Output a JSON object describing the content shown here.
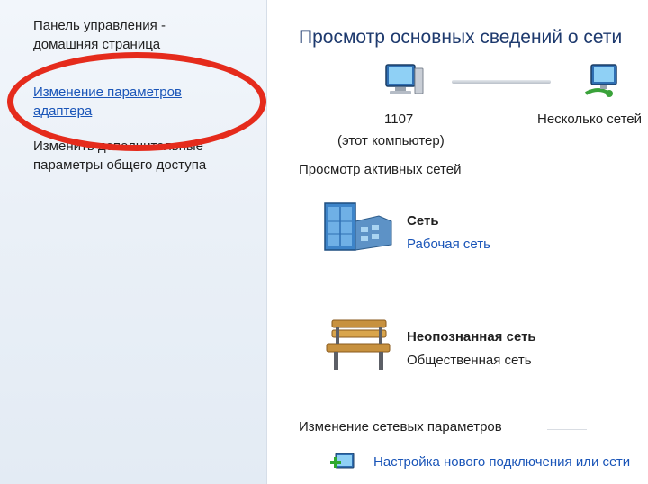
{
  "sidebar": {
    "control_panel_home": "Панель управления -\nдомашняя страница",
    "change_adapter_settings": "Изменение параметров\nадаптера",
    "change_sharing_settings": "Изменить дополнительные\nпараметры общего доступа"
  },
  "main": {
    "title": "Просмотр основных сведений о сети",
    "this_computer_name": "1107",
    "this_computer_caption": "(этот компьютер)",
    "multiple_networks": "Несколько сетей",
    "active_networks_title": "Просмотр активных сетей",
    "networks": [
      {
        "name": "Сеть",
        "type": "Рабочая сеть",
        "type_is_link": true
      },
      {
        "name": "Неопознанная сеть",
        "type": "Общественная сеть",
        "type_is_link": false
      }
    ],
    "change_settings_title": "Изменение сетевых параметров",
    "setup_connection_link": "Настройка нового подключения или сети"
  },
  "colors": {
    "link": "#1a55b8",
    "highlight_ring": "#e52b1c",
    "title": "#1e3a6e"
  },
  "icons": {
    "computer": "computer-icon",
    "network_globe": "network-icon",
    "work_network": "building-icon",
    "public_network": "bench-icon",
    "new_connection": "new-connection-icon"
  }
}
